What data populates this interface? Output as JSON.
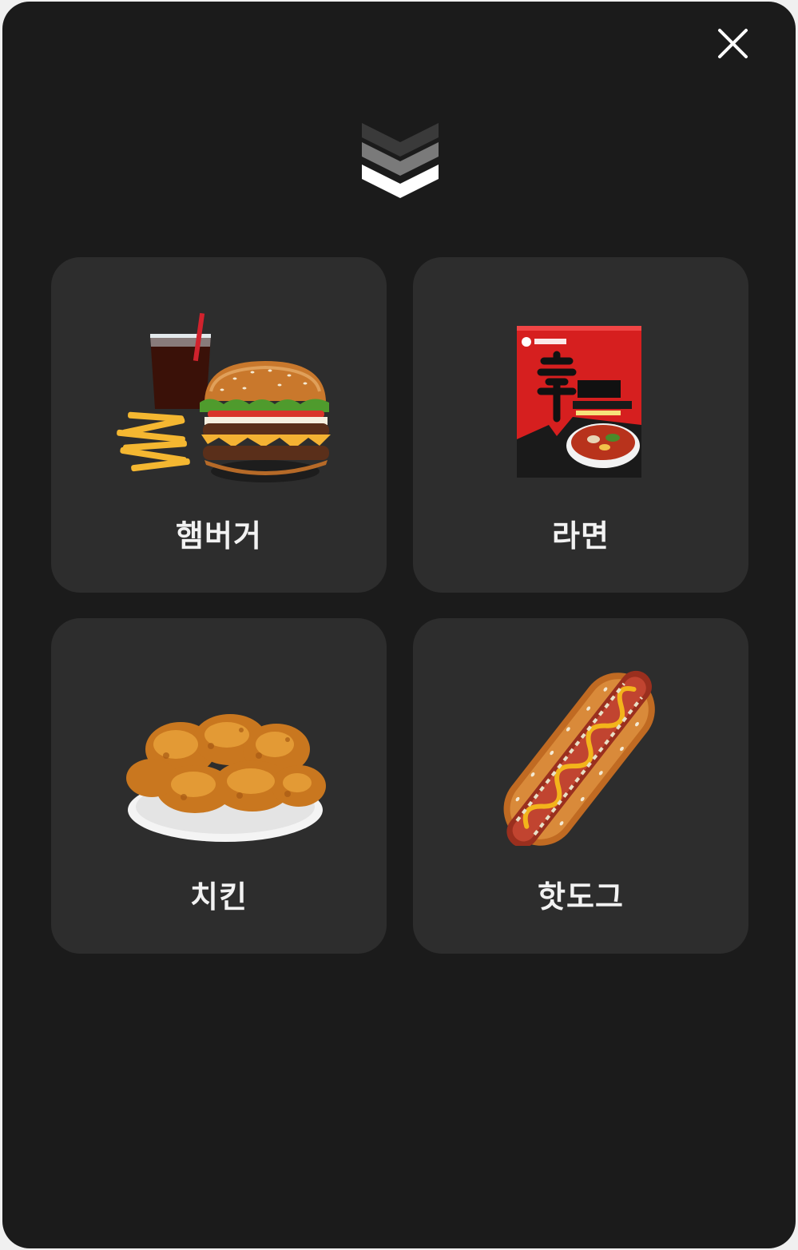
{
  "dialog": {
    "close_icon": "close-icon",
    "header_icon": "triple-chevron-down-icon"
  },
  "menu": {
    "items": [
      {
        "label": "햄버거",
        "image": "burger-meal-image"
      },
      {
        "label": "라면",
        "image": "ramen-package-image"
      },
      {
        "label": "치킨",
        "image": "fried-chicken-image"
      },
      {
        "label": "핫도그",
        "image": "hotdog-image"
      }
    ]
  },
  "colors": {
    "background": "#1b1b1b",
    "card": "#2d2d2d",
    "text": "#f2f2f2"
  }
}
